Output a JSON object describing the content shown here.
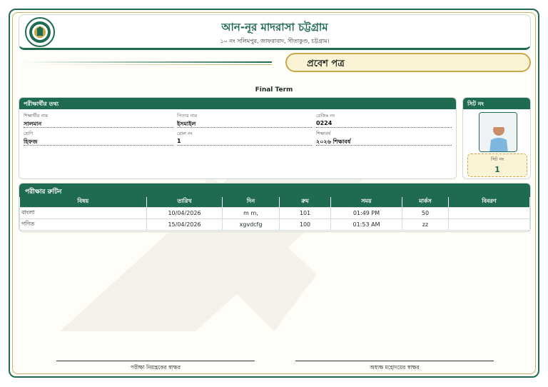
{
  "header": {
    "school_name": "আন-নূর মাদরাসা চট্টগ্রাম",
    "address": "১০ নং সলিমপুর, জাফরাবাদ, সীতাকুণ্ড, চট্টগ্রাম।"
  },
  "document_title": "প্রবেশ পত্র",
  "exam_term": "Final Term",
  "student_info": {
    "section_title": "পরীক্ষার্থীর তথ্য",
    "fields": [
      {
        "label": "শিক্ষার্থীর নাম",
        "value": "সালমান"
      },
      {
        "label": "পিতার নাম",
        "value": "ইসমাইল"
      },
      {
        "label": "রেজিঃ নং",
        "value": "0224"
      },
      {
        "label": "শ্রেণি",
        "value": "হিফজ"
      },
      {
        "label": "রোল নং",
        "value": "1"
      },
      {
        "label": "শিক্ষাবর্ষ",
        "value": "২০২৬ শিক্ষাবর্ষ"
      }
    ]
  },
  "seat": {
    "section_title": "সিট নং",
    "label": "সিট নং",
    "value": "1"
  },
  "routine": {
    "section_title": "পরীক্ষার রুটিন",
    "columns": [
      "বিষয়",
      "তারিখ",
      "দিন",
      "রুম",
      "সময়",
      "মার্কস",
      "বিবরণ"
    ],
    "rows": [
      [
        "বাংলা",
        "10/04/2026",
        "m m,",
        "101",
        "01:49 PM",
        "50",
        ""
      ],
      [
        "গণিত",
        "15/04/2026",
        "xgvdcfg",
        "100",
        "01:53 AM",
        "zz",
        ""
      ]
    ]
  },
  "signatures": {
    "left": "পরীক্ষা নিয়ন্ত্রকের স্বাক্ষর",
    "right": "অধ্যক্ষ মহোদয়ের স্বাক্ষর"
  },
  "colors": {
    "primary_green": "#1f6b4f",
    "gold": "#c9a84a",
    "pill_bg": "#fbf3d6"
  }
}
